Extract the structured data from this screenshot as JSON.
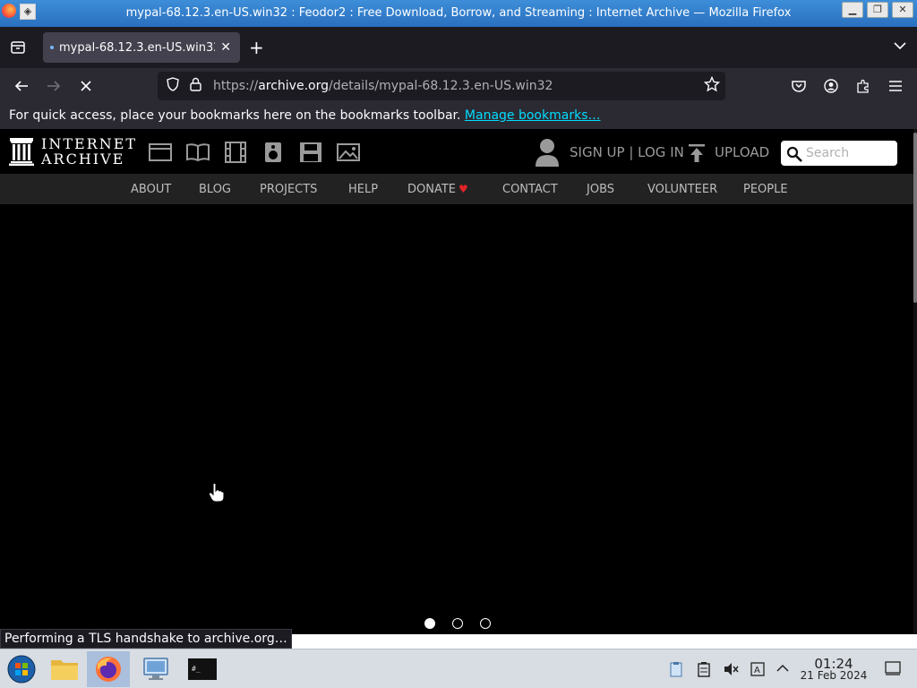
{
  "window": {
    "title": "mypal-68.12.3.en-US.win32 : Feodor2 : Free Download, Borrow, and Streaming : Internet Archive — Mozilla Firefox"
  },
  "tab": {
    "title": "mypal-68.12.3.en-US.win32",
    "close": "✕"
  },
  "url": {
    "scheme": "https://",
    "host": "archive.org",
    "path": "/details/mypal-68.12.3.en-US.win32"
  },
  "bookmarks_bar": {
    "message": "For quick access, place your bookmarks here on the bookmarks toolbar.",
    "link": "Manage bookmarks…"
  },
  "ia": {
    "logo_line1": "INTERNET",
    "logo_line2": "ARCHIVE",
    "signup": "SIGN UP | LOG IN",
    "upload": "UPLOAD",
    "search_placeholder": "Search",
    "nav": [
      "ABOUT",
      "BLOG",
      "PROJECTS",
      "HELP",
      "DONATE",
      "CONTACT",
      "JOBS",
      "VOLUNTEER",
      "PEOPLE"
    ]
  },
  "status": {
    "text": "Performing a TLS handshake to archive.org…"
  },
  "clock": {
    "time": "01:24",
    "date": "21 Feb 2024"
  },
  "carousel": {
    "active_index": 0,
    "count": 3
  },
  "icons": {
    "media": [
      "web-icon",
      "texts-icon",
      "video-icon",
      "audio-icon",
      "software-icon",
      "images-icon"
    ]
  }
}
